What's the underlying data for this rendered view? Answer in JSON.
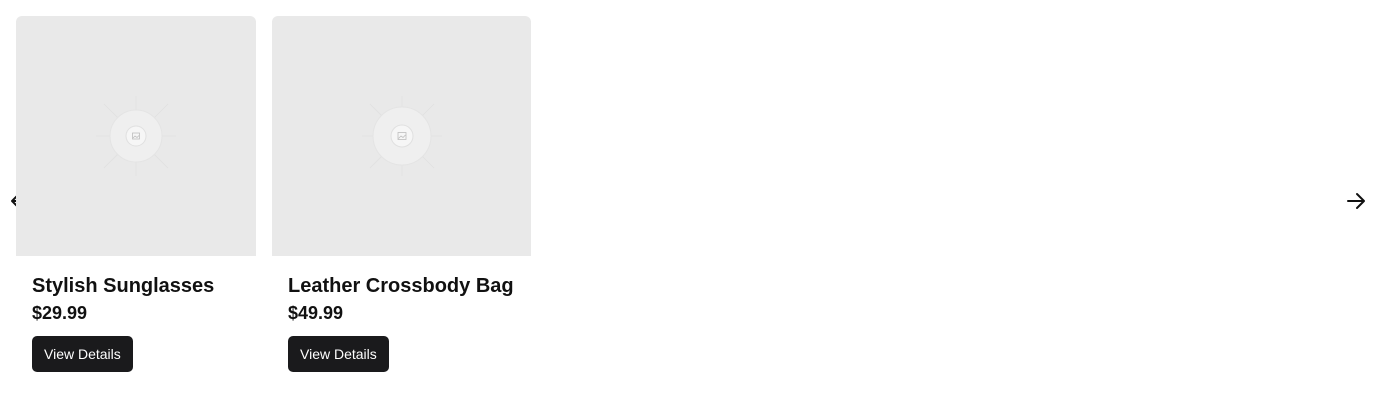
{
  "carousel": {
    "prev_icon": "arrow-left-icon",
    "next_icon": "arrow-right-icon",
    "products": [
      {
        "title": "Stylish Sunglasses",
        "price": "$29.99",
        "button_label": "View Details",
        "image_icon": "image-placeholder-icon"
      },
      {
        "title": "Leather Crossbody Bag",
        "price": "$49.99",
        "button_label": "View Details",
        "image_icon": "image-placeholder-icon"
      }
    ]
  },
  "colors": {
    "image_background": "#e9e9e9",
    "button_background": "#1a1a1c",
    "button_text": "#ffffff",
    "text": "#111111"
  }
}
